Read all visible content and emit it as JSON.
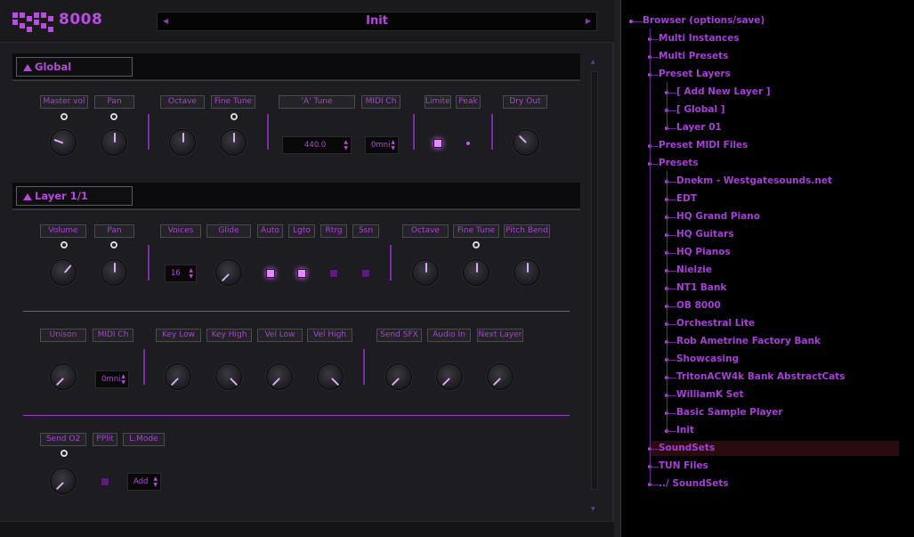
{
  "header": {
    "logo_text": "8008",
    "preset_name": "Init"
  },
  "global": {
    "title": "Global",
    "labels": [
      "Master vol",
      "Pan",
      "Octave",
      "Fine Tune",
      "'A' Tune",
      "MIDI Ch",
      "Limiter",
      "Peak",
      "Dry Out"
    ],
    "a_tune_value": "440.0",
    "midi_ch_value": "0mni"
  },
  "layer": {
    "title": "Layer 1/1",
    "row1_labels": [
      "Volume",
      "Pan",
      "Voices",
      "Glide",
      "Auto",
      "Lgto",
      "Rtrg",
      "Ssn",
      "Octave",
      "Fine Tune",
      "Pitch Bend"
    ],
    "voices_value": "16",
    "row2_labels": [
      "Unison",
      "MIDI Ch",
      "Key Low",
      "Key High",
      "Vel Low",
      "Vel High",
      "Send SFX",
      "Audio In",
      "Next Layer"
    ],
    "midi_ch_value": "0mni",
    "row3_labels": [
      "Send O2",
      "PPlit",
      "L.Mode"
    ],
    "lmode_value": "Add"
  },
  "browser": {
    "items": [
      {
        "label": "Browser (options/save)",
        "level": 0
      },
      {
        "label": "Multi Instances",
        "level": 1
      },
      {
        "label": "Multi Presets",
        "level": 1
      },
      {
        "label": "Preset Layers",
        "level": 1
      },
      {
        "label": "[ Add New Layer ]",
        "level": 2
      },
      {
        "label": "[ Global ]",
        "level": 2
      },
      {
        "label": "Layer 01",
        "level": 2
      },
      {
        "label": "Preset MIDI Files",
        "level": 1
      },
      {
        "label": "Presets",
        "level": 1
      },
      {
        "label": "Dnekm - Westgatesounds.net",
        "level": 2
      },
      {
        "label": "EDT",
        "level": 2
      },
      {
        "label": "HQ Grand Piano",
        "level": 2
      },
      {
        "label": "HQ Guitars",
        "level": 2
      },
      {
        "label": "HQ Pianos",
        "level": 2
      },
      {
        "label": "Nielzie",
        "level": 2
      },
      {
        "label": "NT1 Bank",
        "level": 2
      },
      {
        "label": "OB 8000",
        "level": 2
      },
      {
        "label": "Orchestral Lite",
        "level": 2
      },
      {
        "label": "Rob Ametrine Factory Bank",
        "level": 2
      },
      {
        "label": "Showcasing",
        "level": 2
      },
      {
        "label": "TritonACW4k Bank AbstractCats",
        "level": 2
      },
      {
        "label": "WilliamK Set",
        "level": 2
      },
      {
        "label": "Basic Sample Player",
        "level": 2
      },
      {
        "label": "Init",
        "level": 2
      },
      {
        "label": "SoundSets",
        "level": 1
      },
      {
        "label": "TUN Files",
        "level": 1
      },
      {
        "label": "../ SoundSets",
        "level": 1
      }
    ],
    "selected": "SoundSets"
  },
  "colors": {
    "accent": "#b44ad8",
    "background": "#1d1d21",
    "browser_bg": "#000000"
  }
}
